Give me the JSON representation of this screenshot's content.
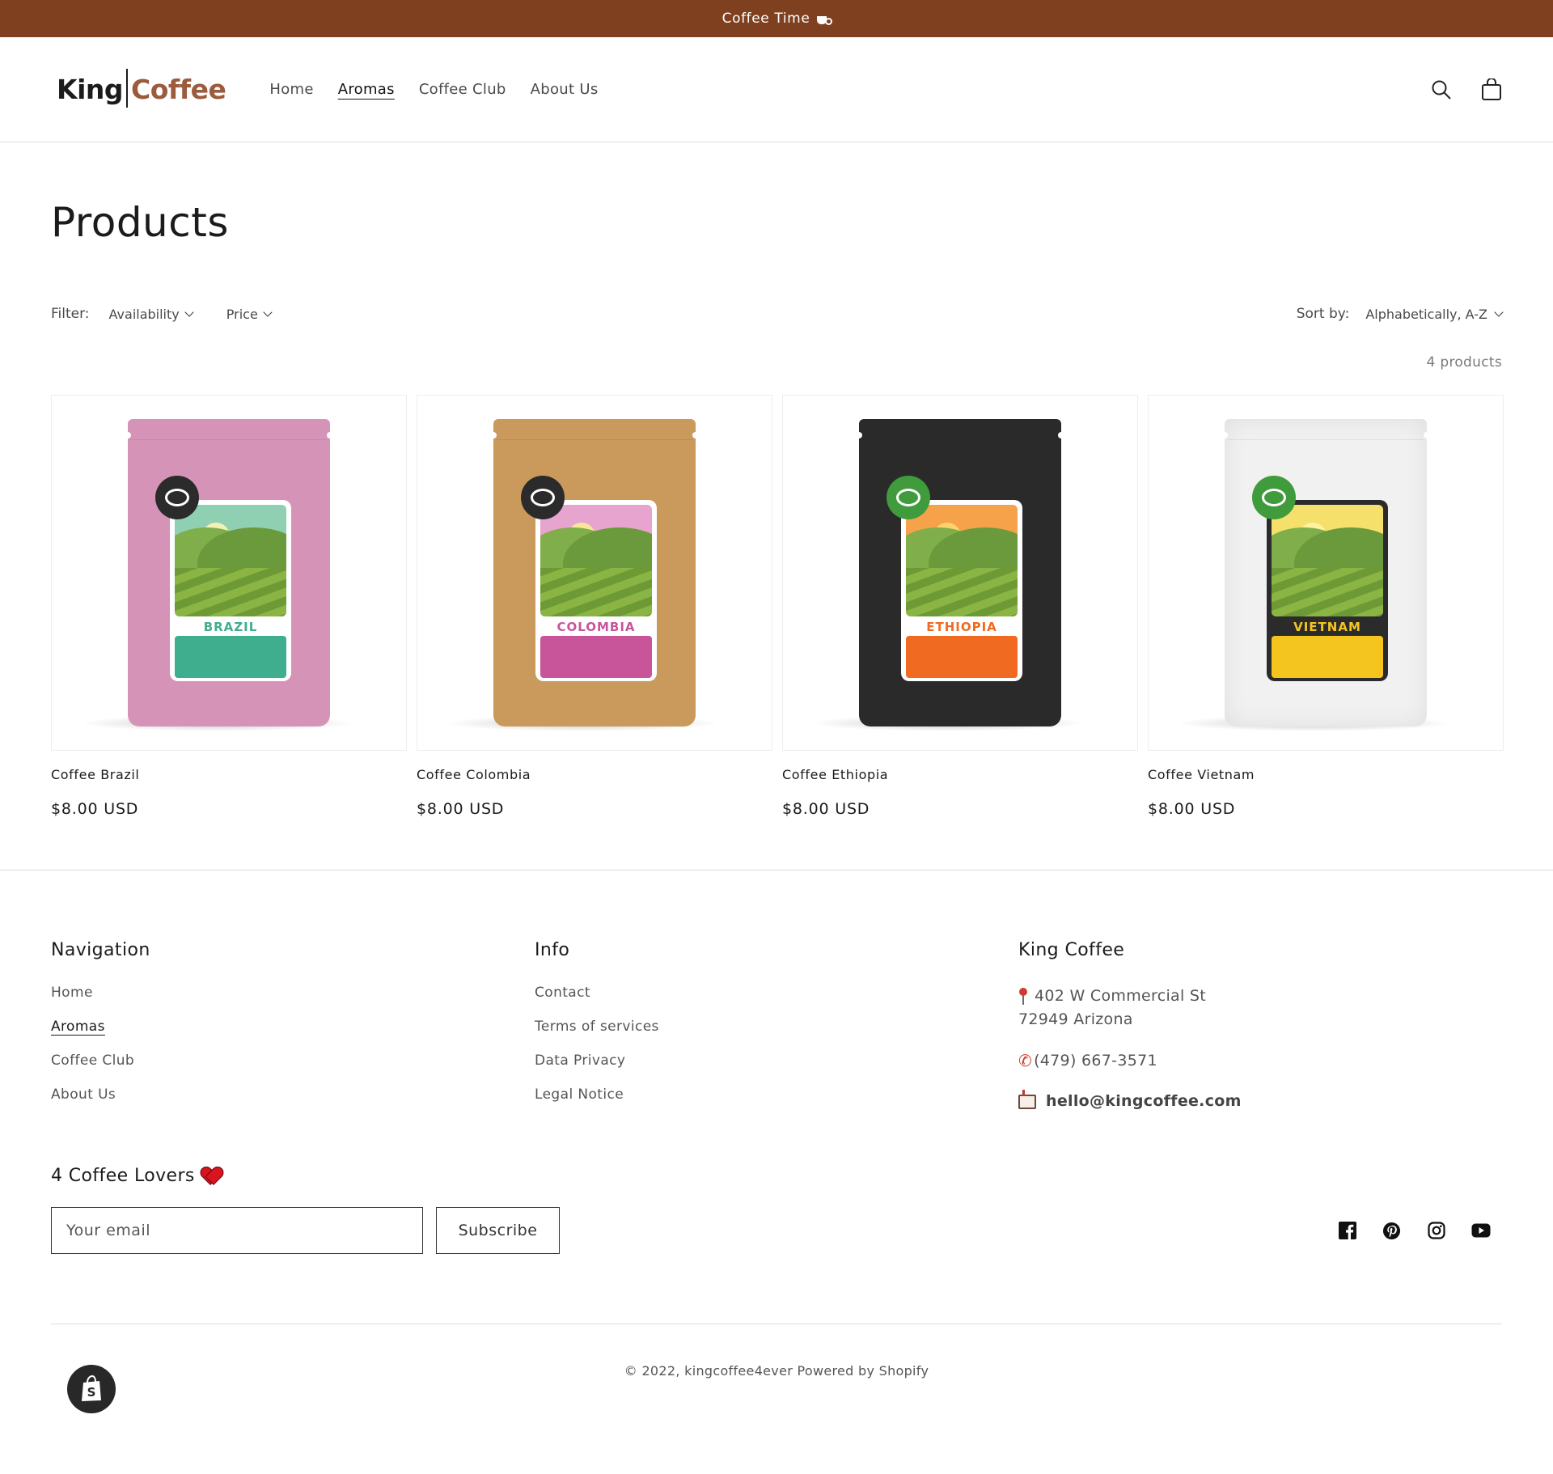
{
  "announcement": {
    "text": "Coffee Time"
  },
  "header": {
    "logo_left": "King",
    "logo_right": "Coffee",
    "nav": [
      {
        "label": "Home"
      },
      {
        "label": "Aromas",
        "active": true
      },
      {
        "label": "Coffee Club"
      },
      {
        "label": "About Us"
      }
    ],
    "icons": [
      "search-icon",
      "cart-icon"
    ]
  },
  "main": {
    "title": "Products",
    "filter_label": "Filter:",
    "filters": [
      "Availability",
      "Price"
    ],
    "sort_label": "Sort by:",
    "sort_value": "Alphabetically, A-Z",
    "count": "4 products",
    "products": [
      {
        "title": "Coffee Brazil",
        "price": "$8.00 USD",
        "bag_label": "BRAZIL",
        "bag_color": "#d693b8",
        "accent": "#3fae8e",
        "scene": "#8fd0b3",
        "sun": "#f4f1b5",
        "badge": "#2b2b2b"
      },
      {
        "title": "Coffee Colombia",
        "price": "$8.00 USD",
        "bag_label": "COLOMBIA",
        "bag_color": "#c99a5b",
        "accent": "#c8559a",
        "scene": "#e7a4cf",
        "sun": "#f8e69a",
        "badge": "#2b2b2b"
      },
      {
        "title": "Coffee Ethiopia",
        "price": "$8.00 USD",
        "bag_label": "ETHIOPIA",
        "bag_color": "#2a2a2a",
        "accent": "#f06a22",
        "scene": "#f6a24a",
        "sun": "#fcd36a",
        "badge": "#3f9b3c"
      },
      {
        "title": "Coffee Vietnam",
        "price": "$8.00 USD",
        "bag_label": "VIETNAM",
        "bag_color": "#f1f1f1",
        "accent": "#f5c51f",
        "scene": "#f4e06a",
        "sun": "#fff3a0",
        "badge": "#3f9b3c"
      }
    ]
  },
  "footer": {
    "navigation": {
      "title": "Navigation",
      "links": [
        {
          "label": "Home"
        },
        {
          "label": "Aromas",
          "active": true
        },
        {
          "label": "Coffee Club"
        },
        {
          "label": "About Us"
        }
      ]
    },
    "info": {
      "title": "Info",
      "links": [
        "Contact",
        "Terms of services",
        "Data Privacy",
        "Legal Notice"
      ]
    },
    "company": {
      "title": "King Coffee",
      "address_line1": "402 W Commercial St",
      "address_line2": "72949 Arizona",
      "phone": "(479) 667-3571",
      "email": "hello@kingcoffee.com"
    },
    "newsletter": {
      "title": "4 Coffee Lovers",
      "placeholder": "Your email",
      "button": "Subscribe"
    },
    "socials": [
      "facebook-icon",
      "pinterest-icon",
      "instagram-icon",
      "youtube-icon"
    ],
    "copyright": "© 2022, kingcoffee4ever Powered by Shopify"
  },
  "colors": {
    "announcement_bg": "#7f4020",
    "logo_brown": "#9b5b3c"
  }
}
